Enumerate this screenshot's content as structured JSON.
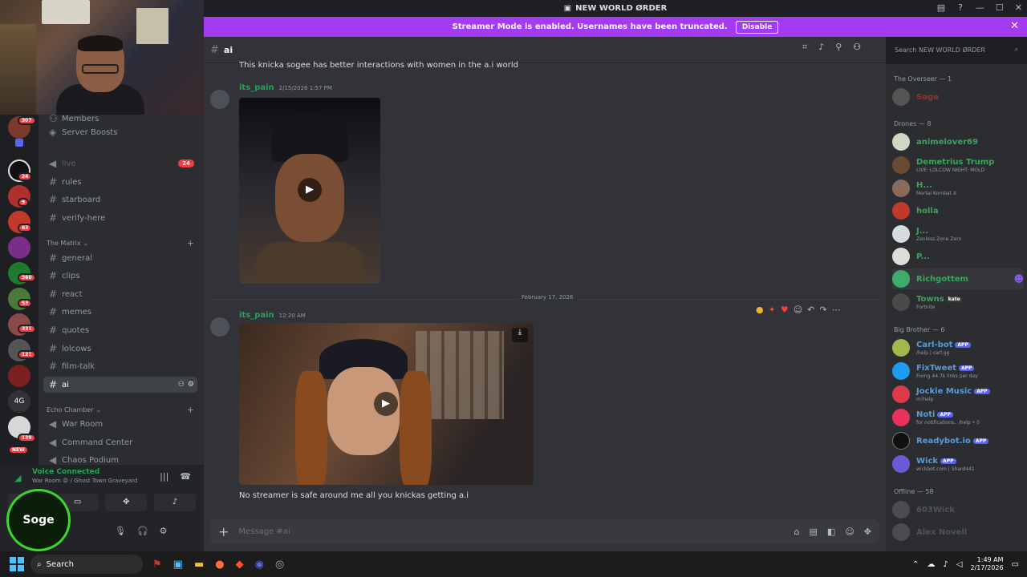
{
  "window": {
    "title": "NEW WORLD ØRDER"
  },
  "banner": {
    "text": "Streamer Mode is enabled. Usernames have been truncated.",
    "button": "Disable"
  },
  "rail": {
    "badges": [
      "307",
      "24",
      "9",
      "63",
      "360",
      "53",
      "331",
      "121",
      "139"
    ],
    "label_4g": "4G",
    "new_tag": "NEW"
  },
  "sidebar": {
    "members_partial": "Members",
    "server_boosts": "Server Boosts",
    "channels_top": [
      {
        "name": "live",
        "badge": "24"
      },
      {
        "name": "rules"
      },
      {
        "name": "starboard"
      },
      {
        "name": "verify-here"
      }
    ],
    "cat_matrix": "The Matrix",
    "matrix_channels": [
      "general",
      "clips",
      "react",
      "memes",
      "quotes",
      "lolcows",
      "film-talk",
      "ai"
    ],
    "cat_echo": "Echo Chamber",
    "echo_channels": [
      "War Room",
      "Command Center",
      "Chaos Podium"
    ]
  },
  "voice": {
    "status": "Voice Connected",
    "location": "War Room 😡 / Ghost Town Graveyard",
    "username": "Soge"
  },
  "channel": {
    "name": "ai"
  },
  "search": {
    "placeholder": "Search NEW WORLD ØRDER"
  },
  "messages": {
    "top_text": "This knicka sogee has better interactions with women in the a.i world",
    "m1": {
      "user": "its_pain",
      "time": "2/15/2026 1:57 PM"
    },
    "date_divider": "February 17, 2026",
    "m2": {
      "user": "its_pain",
      "time": "12:20 AM",
      "text": "No streamer is safe around me all you knickas getting a.i"
    }
  },
  "composer": {
    "placeholder": "Message #ai"
  },
  "members": {
    "overseer_header": "The Overseer — 1",
    "overseer": [
      {
        "name": "Soge",
        "color": "#c0392b"
      }
    ],
    "drones_header": "Drones — 8",
    "drones": [
      {
        "name": "animelover69",
        "sub": "",
        "color": "#3ba55c"
      },
      {
        "name": "Demetrius Trump",
        "sub": "LIVE: LOLCOW NIGHT: MOLD",
        "color": "#3ba55c"
      },
      {
        "name": "H...",
        "sub": "Mortal Kombat X",
        "color": "#3ba55c"
      },
      {
        "name": "holla",
        "sub": "",
        "color": "#3ba55c"
      },
      {
        "name": "J...",
        "sub": "Zenless Zone Zero",
        "color": "#3ba55c"
      },
      {
        "name": "P...",
        "sub": "",
        "color": "#3ba55c"
      },
      {
        "name": "Richgottem",
        "sub": "",
        "color": "#3ba55c"
      },
      {
        "name": "Towns",
        "sub": "Fortnite",
        "color": "#3ba55c",
        "tag": "kate"
      }
    ],
    "bigbrother_header": "Big Brother — 6",
    "bots": [
      {
        "name": "Carl-bot",
        "sub": "/help | carl.gg",
        "color": "#5b9bd5"
      },
      {
        "name": "FixTweet",
        "sub": "Fixing 44.7k links per day",
        "color": "#5b9bd5"
      },
      {
        "name": "Jockie Music",
        "sub": "m!help",
        "color": "#5b9bd5"
      },
      {
        "name": "Noti",
        "sub": "for notifications.. /help • 0",
        "color": "#5b9bd5"
      },
      {
        "name": "Readybot.io",
        "sub": "",
        "color": "#5b9bd5"
      },
      {
        "name": "Wick",
        "sub": "wickbot.com | Shard441",
        "color": "#5b9bd5"
      }
    ],
    "app_tag": "APP",
    "offline_header": "Offline — 58",
    "offline": [
      "603Wick",
      "Alex Novell"
    ]
  },
  "taskbar": {
    "search": "Search",
    "time": "1:49 AM",
    "date": "2/17/2026"
  }
}
